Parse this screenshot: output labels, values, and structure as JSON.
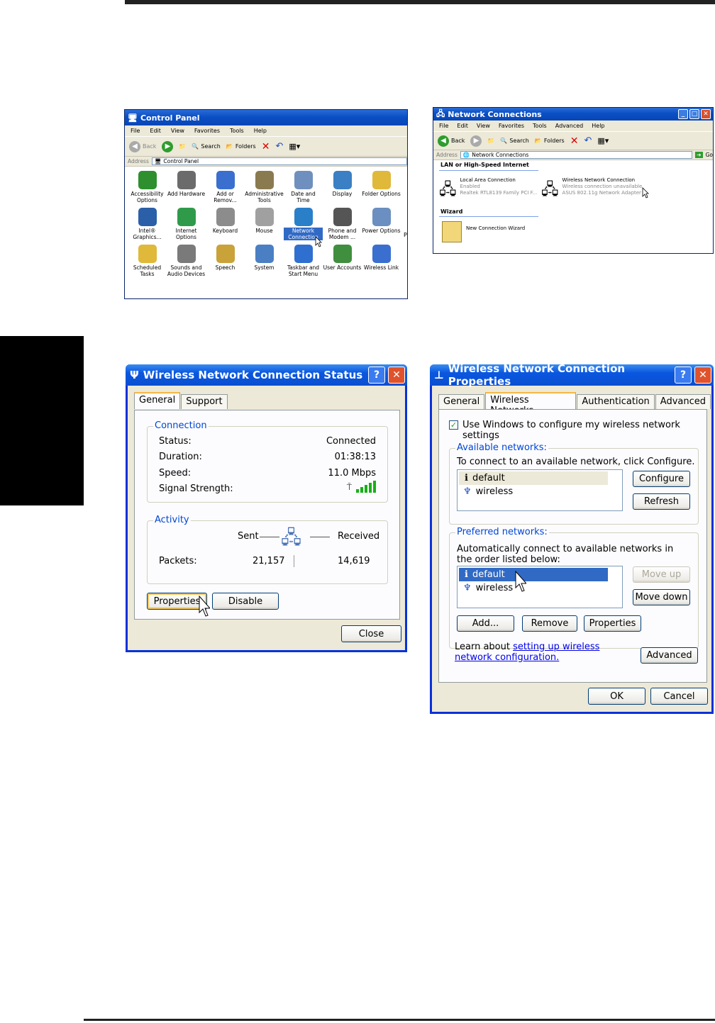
{
  "control_panel": {
    "title": "Control Panel",
    "menu": [
      "File",
      "Edit",
      "View",
      "Favorites",
      "Tools",
      "Help"
    ],
    "toolbar": {
      "back": "Back",
      "search": "Search",
      "folders": "Folders"
    },
    "address_label": "Address",
    "address_value": "Control Panel",
    "items": [
      {
        "label": "Accessibility Options",
        "icon": "accessibility-icon",
        "color": "#2d8f2d"
      },
      {
        "label": "Add Hardware",
        "icon": "add-hardware-icon",
        "color": "#6b6b6b"
      },
      {
        "label": "Add or Remov...",
        "icon": "add-remove-icon",
        "color": "#3b6fcf"
      },
      {
        "label": "Administrative Tools",
        "icon": "admin-tools-icon",
        "color": "#8a7a50"
      },
      {
        "label": "Date and Time",
        "icon": "clock-icon",
        "color": "#6f8fbf"
      },
      {
        "label": "Display",
        "icon": "display-icon",
        "color": "#3b7fc4"
      },
      {
        "label": "Folder Options",
        "icon": "folder-icon",
        "color": "#e0b83a"
      },
      {
        "label": "Intel® Graphics...",
        "icon": "intel-graphics-icon",
        "color": "#2b5fa8"
      },
      {
        "label": "Internet Options",
        "icon": "globe-icon",
        "color": "#2f9b4a"
      },
      {
        "label": "Keyboard",
        "icon": "keyboard-icon",
        "color": "#8c8c8c"
      },
      {
        "label": "Mouse",
        "icon": "mouse-icon",
        "color": "#a0a0a0"
      },
      {
        "label": "Network Connection",
        "icon": "network-globe-icon",
        "color": "#2a7fc9",
        "selected": true
      },
      {
        "label": "Phone and Modem ...",
        "icon": "phone-icon",
        "color": "#555555"
      },
      {
        "label": "Power Options",
        "icon": "power-icon",
        "color": "#6a8fc0"
      },
      {
        "label": "Scheduled Tasks",
        "icon": "scheduled-tasks-icon",
        "color": "#e0b83a"
      },
      {
        "label": "Sounds and Audio Devices",
        "icon": "speaker-icon",
        "color": "#7a7a7a"
      },
      {
        "label": "Speech",
        "icon": "speech-icon",
        "color": "#c9a23a"
      },
      {
        "label": "System",
        "icon": "system-icon",
        "color": "#4a7fc4"
      },
      {
        "label": "Taskbar and Start Menu",
        "icon": "taskbar-icon",
        "color": "#2f6fd0"
      },
      {
        "label": "User Accounts",
        "icon": "user-accounts-icon",
        "color": "#3f8f3f"
      },
      {
        "label": "Wireless Link",
        "icon": "wireless-link-icon",
        "color": "#3b6fcf"
      }
    ],
    "edge_char": "P"
  },
  "network_connections": {
    "title": "Network Connections",
    "menu": [
      "File",
      "Edit",
      "View",
      "Favorites",
      "Tools",
      "Advanced",
      "Help"
    ],
    "toolbar": {
      "back": "Back",
      "search": "Search",
      "folders": "Folders"
    },
    "address_label": "Address",
    "address_value": "Network Connections",
    "go": "Go",
    "section_lan": "LAN or High-Speed Internet",
    "lan": {
      "name": "Local Area Connection",
      "status": "Enabled",
      "device": "Realtek RTL8139 Family PCI F..."
    },
    "wlan": {
      "name": "Wireless Network Connection",
      "status": "Wireless connection unavailable",
      "device": "ASUS 802.11g Network Adapter"
    },
    "section_wizard": "Wizard",
    "wizard": "New Connection Wizard"
  },
  "status_dialog": {
    "title": "Wireless Network Connection Status",
    "tabs": [
      "General",
      "Support"
    ],
    "connection_legend": "Connection",
    "rows": [
      {
        "label": "Status:",
        "value": "Connected"
      },
      {
        "label": "Duration:",
        "value": "01:38:13"
      },
      {
        "label": "Speed:",
        "value": "11.0 Mbps"
      },
      {
        "label": "Signal Strength:",
        "value": ""
      }
    ],
    "activity_legend": "Activity",
    "sent": "Sent",
    "received": "Received",
    "packets_label": "Packets:",
    "packets_sent": "21,157",
    "packets_received": "14,619",
    "properties": "Properties",
    "disable": "Disable",
    "close": "Close"
  },
  "properties_dialog": {
    "title": "Wireless Network Connection Properties",
    "tabs": [
      "General",
      "Wireless Networks",
      "Authentication",
      "Advanced"
    ],
    "use_windows": "Use Windows to configure my wireless network settings",
    "available_legend": "Available networks:",
    "available_help": "To connect to an available network, click Configure.",
    "available": [
      "default",
      "wireless"
    ],
    "configure": "Configure",
    "refresh": "Refresh",
    "preferred_legend": "Preferred networks:",
    "preferred_help": "Automatically connect to available networks in the order listed below:",
    "preferred": [
      "default",
      "wireless"
    ],
    "move_up": "Move up",
    "move_down": "Move down",
    "add": "Add...",
    "remove": "Remove",
    "properties": "Properties",
    "learn_prefix": "Learn about",
    "learn_link": "setting up wireless network configuration.",
    "advanced": "Advanced",
    "ok": "OK",
    "cancel": "Cancel"
  }
}
